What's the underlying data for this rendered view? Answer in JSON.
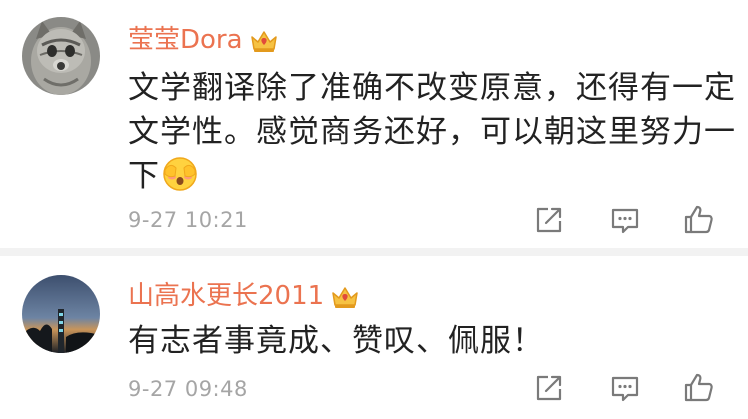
{
  "comments": [
    {
      "username": "莹莹Dora",
      "badge_icon": "crown-vip-icon",
      "content_lines": [
        "文学翻译除了准确不改变原意，还得有一定",
        "文学性。感觉商务还好，可以朝这里努力一",
        "下"
      ],
      "content_emoji": "shy-face-emoji-icon",
      "timestamp": "9-27 10:21"
    },
    {
      "username": "山高水更长2011",
      "badge_icon": "crown-vip-icon",
      "content_lines": [
        "有志者事竟成、赞叹、佩服！"
      ],
      "timestamp": "9-27 09:48"
    }
  ],
  "actions": {
    "share_icon": "share-icon",
    "comment_icon": "comment-icon",
    "like_icon": "like-icon"
  },
  "colors": {
    "username": "#eb7350",
    "text": "#222222",
    "meta": "#a5a5a5",
    "divider": "#f2f2f2"
  }
}
